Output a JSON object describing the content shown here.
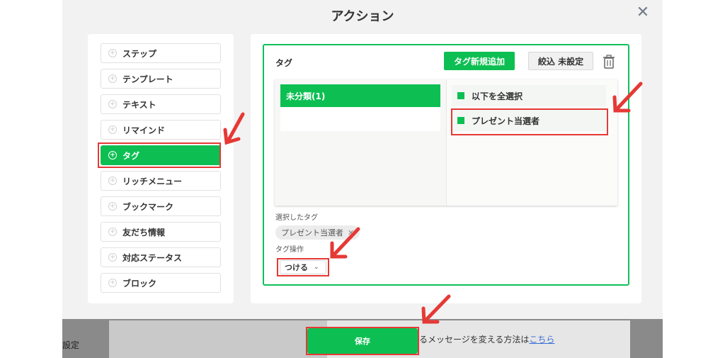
{
  "background": {
    "left_text": "設定",
    "help_text": "るメッセージを変える方法は",
    "help_link": "こちら"
  },
  "modal": {
    "title": "アクション",
    "close_icon": "close-icon"
  },
  "sidebar": {
    "items": [
      {
        "label": "ステップ"
      },
      {
        "label": "テンプレート"
      },
      {
        "label": "テキスト"
      },
      {
        "label": "リマインド"
      },
      {
        "label": "タグ",
        "active": true
      },
      {
        "label": "リッチメニュー"
      },
      {
        "label": "ブックマーク"
      },
      {
        "label": "友だち情報"
      },
      {
        "label": "対応ステータス"
      },
      {
        "label": "ブロック"
      }
    ]
  },
  "tag_panel": {
    "title": "タグ",
    "new_tag_button": "タグ新規追加",
    "filter_button": "絞込 未設定",
    "trash_icon": "trash-icon",
    "categories": [
      {
        "label": "未分類(1)"
      }
    ],
    "tags": [
      {
        "label": "以下を全選択"
      },
      {
        "label": "プレゼント当選者"
      }
    ],
    "selected_label": "選択したタグ",
    "selected_tags": [
      {
        "label": "プレゼント当選者",
        "remove": "✕"
      }
    ],
    "operation_label": "タグ操作",
    "operation_value": "つける",
    "operation_chevron": "⌄"
  },
  "footer": {
    "save_button": "保存"
  },
  "colors": {
    "accent": "#0dbf52",
    "frame": "#10c05a",
    "highlight": "#e53935"
  }
}
